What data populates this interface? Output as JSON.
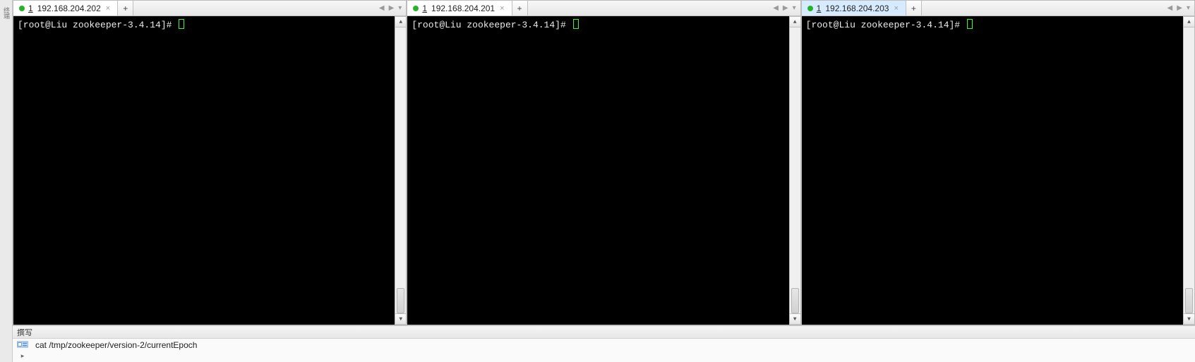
{
  "left_gutter": {
    "label": "终端"
  },
  "panes": [
    {
      "tab": {
        "status": "connected",
        "num": "1",
        "title": "192.168.204.202",
        "active": false
      },
      "prompt": "[root@Liu zookeeper-3.4.14]# "
    },
    {
      "tab": {
        "status": "connected",
        "num": "1",
        "title": "192.168.204.201",
        "active": false
      },
      "prompt": "[root@Liu zookeeper-3.4.14]# "
    },
    {
      "tab": {
        "status": "connected",
        "num": "1",
        "title": "192.168.204.203",
        "active": true
      },
      "prompt": "[root@Liu zookeeper-3.4.14]# "
    }
  ],
  "tab_controls": {
    "add": "+",
    "close": "×",
    "prev": "◀",
    "next": "▶",
    "menu": "▾"
  },
  "scrollbar": {
    "up": "▲",
    "down": "▼"
  },
  "bottom": {
    "header": "撰写",
    "compose_text": "cat /tmp/zookeeper/version-2/currentEpoch"
  }
}
